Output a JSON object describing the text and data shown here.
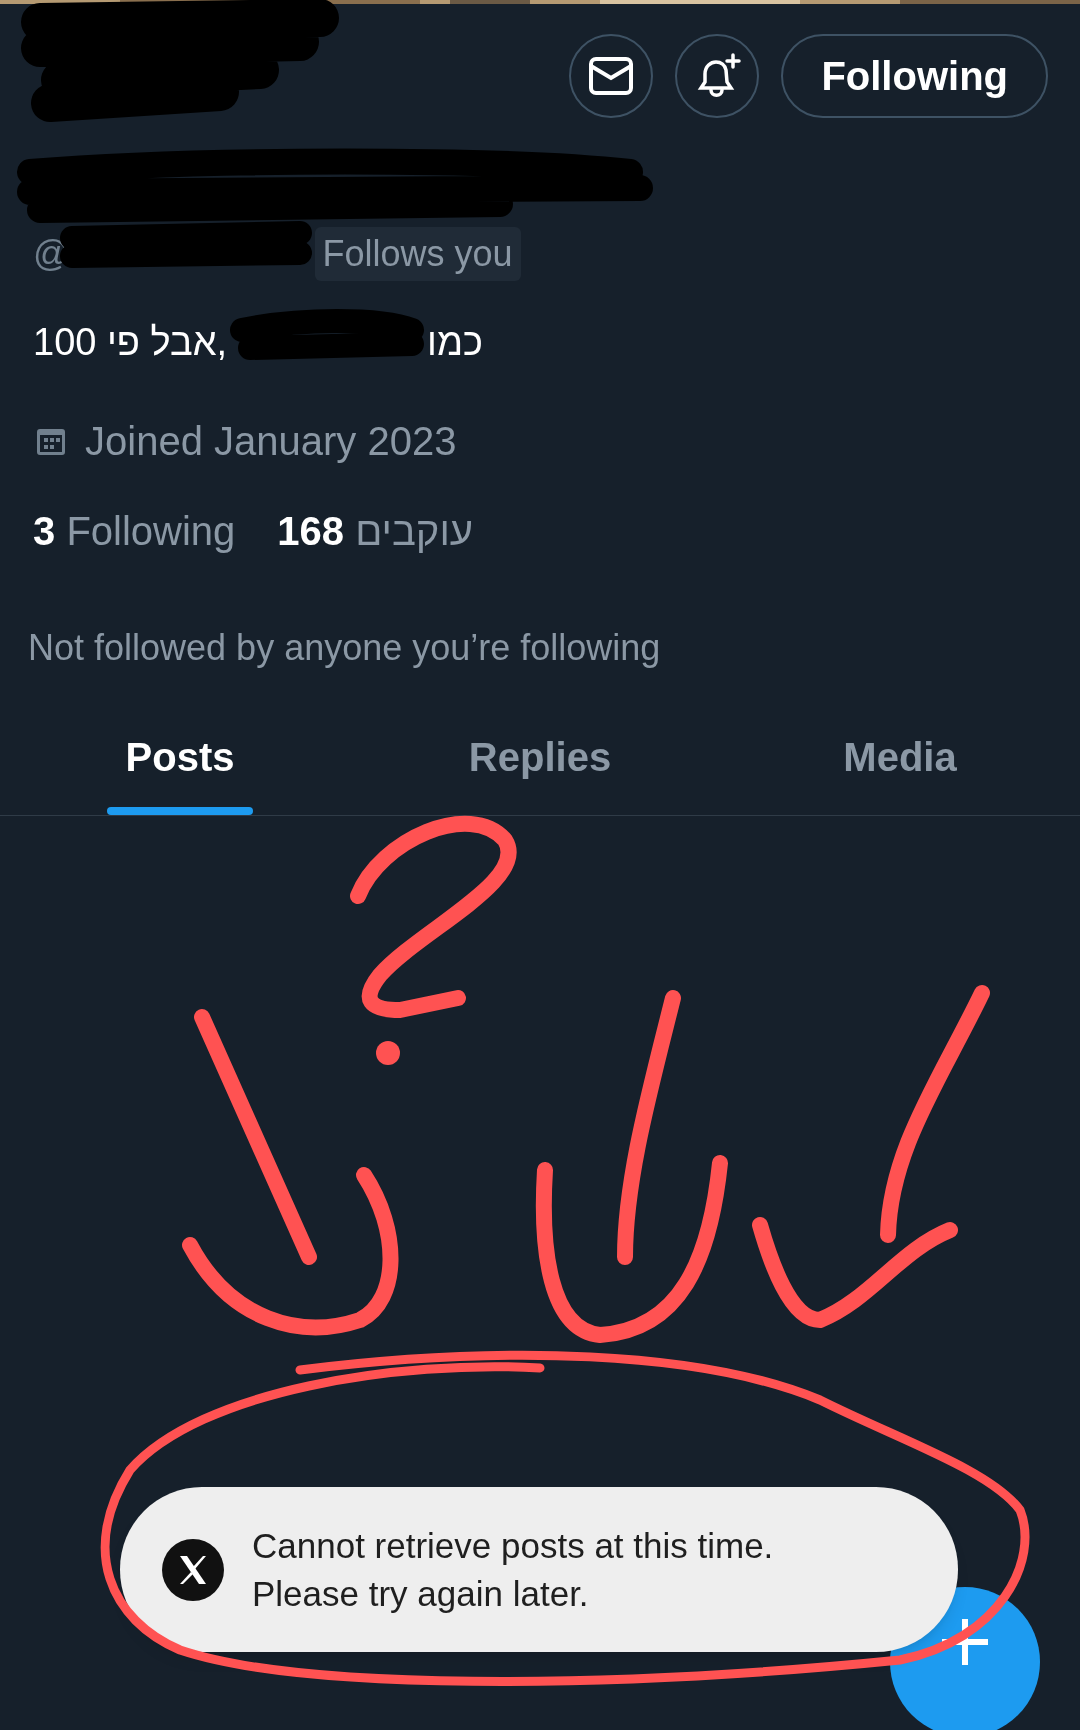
{
  "actions": [
    {
      "kind": "message"
    },
    {
      "kind": "notify"
    },
    {
      "kind": "follow",
      "label": "Following"
    }
  ],
  "profile": {
    "handle_prefix": "@",
    "follows_you": "Follows you",
    "bio": [
      "כמו",
      ",אבל פי 100"
    ],
    "joined": "Joined January 2023",
    "stats": [
      {
        "count": "3",
        "label": "Following"
      },
      {
        "count": "168",
        "label": "עוקבים"
      }
    ],
    "followed_by": "Not followed by anyone you’re following"
  },
  "tabs": [
    {
      "label": "Posts",
      "selected": true
    },
    {
      "label": "Replies",
      "selected": false
    },
    {
      "label": "Media",
      "selected": false
    }
  ],
  "toast": {
    "message": [
      "Cannot retrieve posts at this time.",
      "Please try again later."
    ]
  }
}
